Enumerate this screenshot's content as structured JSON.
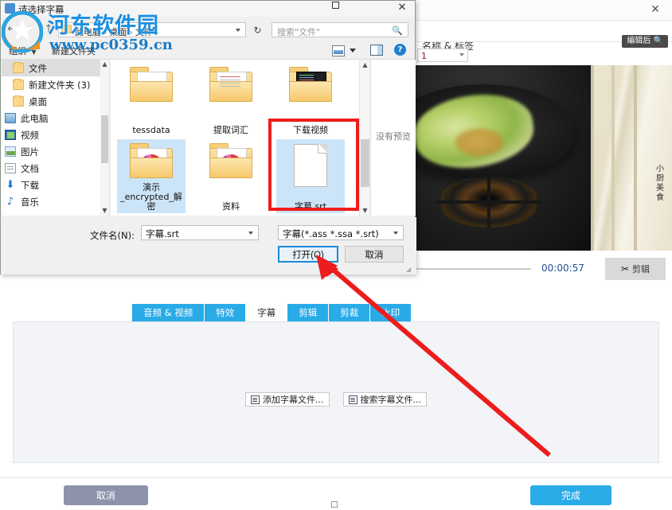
{
  "app": {
    "close_label": "✕",
    "subhead_label": "名称 & 标签",
    "dropdown_value": "1",
    "preview_tooltip": "编辑后",
    "preview_tooltip_icon": "search-icon",
    "video_signature": "小厨美食",
    "timeline": {
      "current_time": "00:00:57",
      "cut_button": "剪辑",
      "cut_icon": "scissors-icon"
    },
    "tabs": [
      {
        "label": "音频 & 视频",
        "active": false
      },
      {
        "label": "特效",
        "active": false
      },
      {
        "label": "字幕",
        "active": true
      },
      {
        "label": "剪辑",
        "active": false
      },
      {
        "label": "剪裁",
        "active": false
      },
      {
        "label": "水印",
        "active": false
      }
    ],
    "panel_actions": [
      {
        "label": "添加字幕文件...",
        "icon": "add-subtitle-file-icon"
      },
      {
        "label": "搜索字幕文件...",
        "icon": "search-subtitle-file-icon"
      }
    ],
    "bottom": {
      "cancel_label": "取消",
      "finish_label": "完成"
    }
  },
  "dialog": {
    "title": "请选择字幕",
    "close_label": "✕",
    "nav": {
      "back_icon": "arrow-left-icon",
      "forward_icon": "arrow-right-icon",
      "up_icon": "arrow-up-icon",
      "refresh_icon": "refresh-icon",
      "refresh_glyph": "↻",
      "back_glyph": "←",
      "forward_glyph": "→",
      "up_glyph": "↑"
    },
    "breadcrumbs": [
      "此电脑",
      "桌面",
      "文件"
    ],
    "search": {
      "placeholder": "搜索\"文件\"",
      "icon": "search-icon"
    },
    "toolbar": {
      "organize_label": "组织",
      "organize_caret": "▼",
      "new_folder_label": "新建文件夹",
      "view_icon": "view-mode-icon",
      "preview_pane_icon": "preview-pane-icon",
      "help_icon": "help-icon",
      "help_glyph": "?"
    },
    "sidebar_items": [
      {
        "label": "文件",
        "icon": "folder-icon",
        "selected": true,
        "type": "folder"
      },
      {
        "label": "新建文件夹 (3)",
        "icon": "folder-icon",
        "selected": false,
        "type": "folder"
      },
      {
        "label": "桌面",
        "icon": "folder-icon",
        "selected": false,
        "type": "folder"
      },
      {
        "label": "此电脑",
        "icon": "computer-icon",
        "selected": false,
        "type": "pc"
      },
      {
        "label": "视频",
        "icon": "video-icon",
        "selected": false,
        "type": "video"
      },
      {
        "label": "图片",
        "icon": "picture-icon",
        "selected": false,
        "type": "pic"
      },
      {
        "label": "文档",
        "icon": "document-icon",
        "selected": false,
        "type": "doc"
      },
      {
        "label": "下载",
        "icon": "download-icon",
        "selected": false,
        "type": "dl",
        "glyph": "⬇"
      },
      {
        "label": "音乐",
        "icon": "music-icon",
        "selected": false,
        "type": "music",
        "glyph": "♪"
      }
    ],
    "files": [
      {
        "name": "tessdata",
        "kind": "folder",
        "style": "plain",
        "selected": false
      },
      {
        "name": "提取词汇",
        "kind": "folder",
        "style": "lines",
        "selected": false
      },
      {
        "name": "下载视频",
        "kind": "folder",
        "style": "dark",
        "selected": false
      },
      {
        "name": "演示_encrypted_解密",
        "kind": "folder",
        "style": "pie",
        "selected": true
      },
      {
        "name": "资料",
        "kind": "folder",
        "style": "pie",
        "selected": false
      },
      {
        "name": "字幕.srt",
        "kind": "file",
        "style": "document",
        "selected": true,
        "highlighted": true
      }
    ],
    "preview_pane_text": "没有预览",
    "filename_label": "文件名(N):",
    "filename_value": "字幕.srt",
    "filetype_value": "字幕(*.ass *.ssa *.srt)",
    "open_button": "打开(O)",
    "cancel_button": "取消"
  },
  "watermark": {
    "title": "河东软件园",
    "url": "www.pc0359.cn"
  },
  "colors": {
    "accent_blue": "#29abe8",
    "tab_blue": "#29abe8",
    "cancel_gray": "#8c93ab",
    "annotation_red": "#ee1c1c",
    "dialog_bg": "#f0f0f0",
    "selection_blue": "#cce4f7"
  }
}
